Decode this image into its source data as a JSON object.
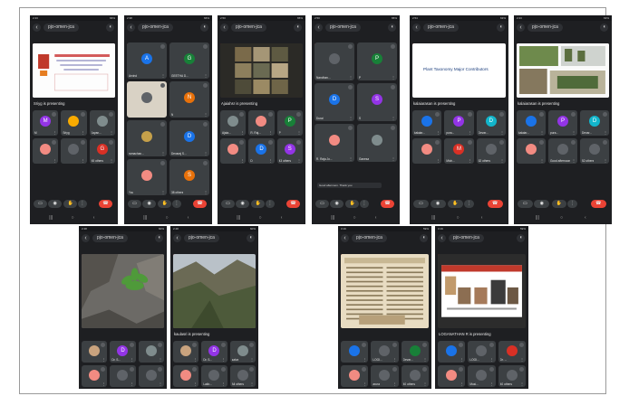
{
  "meeting_code": "pjo-omen-jca",
  "chips": [
    "G",
    "R",
    "M"
  ],
  "phones": [
    {
      "status_time": "2:43",
      "status_right": "66%",
      "presenting": "Sriyg is presenting",
      "tiles": [
        {
          "initial": "M",
          "name": "M",
          "color": "#9334e6"
        },
        {
          "initial": "",
          "name": "Sriyg",
          "color": "#f9ab00"
        },
        {
          "initial": "",
          "name": "Jayan...",
          "color": "#7f8c8d"
        },
        {
          "initial": "",
          "name": "",
          "color": "#f28b82"
        },
        {
          "initial": "",
          "name": "",
          "color": "#5f6368"
        },
        {
          "initial": "G",
          "name": "45 others",
          "color": "#d93025"
        }
      ]
    },
    {
      "status_time": "2:38",
      "status_right": "66%",
      "tiles": [
        {
          "initial": "A",
          "name": "Arvind",
          "color": "#1a73e8"
        },
        {
          "initial": "G",
          "name": "GEETHA D...",
          "color": "#188038"
        },
        {
          "initial": "",
          "name": "",
          "color": "#5f6368"
        },
        {
          "initial": "N",
          "name": "N",
          "color": "#e8710a"
        },
        {
          "initial": "",
          "name": "ramachan...",
          "color": "#c5a04a"
        },
        {
          "initial": "D",
          "name": "Devaraj S...",
          "color": "#1a73e8"
        },
        {
          "initial": "",
          "name": "You",
          "color": "#f28b82"
        },
        {
          "initial": "S",
          "name": "38 others",
          "color": "#e8710a"
        }
      ]
    },
    {
      "status_time": "2:50",
      "status_right": "65%",
      "presenting": "Ajaiahsr is presenting",
      "tiles": [
        {
          "initial": "",
          "name": "Ajaia...",
          "color": "#7f8c8d"
        },
        {
          "initial": "",
          "name": "R. Raj...",
          "color": "#f28b82"
        },
        {
          "initial": "P",
          "name": "P",
          "color": "#188038"
        },
        {
          "initial": "",
          "name": "",
          "color": "#f28b82"
        },
        {
          "initial": "D",
          "name": "D",
          "color": "#1a73e8"
        },
        {
          "initial": "S",
          "name": "43 others",
          "color": "#9334e6"
        }
      ]
    },
    {
      "status_time": "2:50",
      "status_right": "65%",
      "tiles": [
        {
          "initial": "",
          "name": "Nandhan...",
          "color": "#5f6368"
        },
        {
          "initial": "P",
          "name": "P",
          "color": "#188038"
        },
        {
          "initial": "D",
          "name": "Durai",
          "color": "#1a73e8"
        },
        {
          "initial": "S",
          "name": "S",
          "color": "#9334e6"
        },
        {
          "initial": "",
          "name": "R. Raja Jo...",
          "color": "#f28b82"
        },
        {
          "initial": "",
          "name": "Ganesa",
          "color": "#7f8c8d"
        }
      ],
      "toast": "Good afternoon. Thank you"
    },
    {
      "status_time": "2:54",
      "status_right": "63%",
      "presenting": "kalaiarasan is presenting",
      "slide_title": "Plant Taxonomy Major Contributors",
      "tiles": [
        {
          "initial": "",
          "name": "kalaiar...",
          "color": "#1a73e8"
        },
        {
          "initial": "P",
          "name": "pura...",
          "color": "#9334e6"
        },
        {
          "initial": "D",
          "name": "Devar...",
          "color": "#12b5cb"
        },
        {
          "initial": "",
          "name": "",
          "color": "#f28b82"
        },
        {
          "initial": "M",
          "name": "Mich...",
          "color": "#d93025"
        },
        {
          "initial": "",
          "name": "52 others",
          "color": "#5f6368"
        }
      ]
    },
    {
      "status_time": "2:43",
      "status_right": "63%",
      "presenting": "kalaiarasan is presenting",
      "tiles": [
        {
          "initial": "",
          "name": "kalaiar...",
          "color": "#1a73e8"
        },
        {
          "initial": "P",
          "name": "pura...",
          "color": "#9334e6"
        },
        {
          "initial": "D",
          "name": "Devar...",
          "color": "#12b5cb"
        },
        {
          "initial": "",
          "name": "",
          "color": "#f28b82"
        },
        {
          "initial": "",
          "name": "Good afternoon",
          "color": "#5f6368"
        },
        {
          "initial": "",
          "name": "52 others",
          "color": "#5f6368"
        }
      ]
    },
    {
      "status_time": "2:48",
      "status_right": "60%",
      "tiles": [
        {
          "initial": "",
          "name": "",
          "color": "#c9a37e"
        },
        {
          "initial": "D",
          "name": "Dr. S...",
          "color": "#9334e6"
        },
        {
          "initial": "",
          "name": "",
          "color": "#7f8c8d"
        },
        {
          "initial": "",
          "name": "",
          "color": "#f28b82"
        },
        {
          "initial": "",
          "name": "",
          "color": "#5f6368"
        },
        {
          "initial": "",
          "name": "",
          "color": "#5f6368"
        }
      ]
    },
    {
      "status_time": "2:48",
      "status_right": "60%",
      "presenting": "kaulasri is presenting",
      "tiles": [
        {
          "initial": "",
          "name": "",
          "color": "#c9a37e"
        },
        {
          "initial": "D",
          "name": "Dr. S...",
          "color": "#9334e6"
        },
        {
          "initial": "",
          "name": "salva",
          "color": "#7f8c8d"
        },
        {
          "initial": "",
          "name": "",
          "color": "#f28b82"
        },
        {
          "initial": "",
          "name": "Lakb...",
          "color": "#5f6368"
        },
        {
          "initial": "",
          "name": "All others",
          "color": "#5f6368"
        }
      ]
    },
    {
      "status_time": "3:19",
      "status_right": "59%",
      "tiles": [
        {
          "initial": "",
          "name": "",
          "color": "#1a73e8"
        },
        {
          "initial": "",
          "name": "LOGI...",
          "color": "#5f6368"
        },
        {
          "initial": "",
          "name": "Devar...",
          "color": "#188038"
        },
        {
          "initial": "",
          "name": "",
          "color": "#f28b82"
        },
        {
          "initial": "",
          "name": "aruna",
          "color": "#5f6368"
        },
        {
          "initial": "",
          "name": "40 others",
          "color": "#5f6368"
        }
      ]
    },
    {
      "status_time": "3:19",
      "status_right": "59%",
      "presenting": "LOGANATHAN R is presenting",
      "tiles": [
        {
          "initial": "",
          "name": "",
          "color": "#1a73e8"
        },
        {
          "initial": "",
          "name": "LOGI...",
          "color": "#5f6368"
        },
        {
          "initial": "",
          "name": "Dr. ...",
          "color": "#d93025"
        },
        {
          "initial": "",
          "name": "",
          "color": "#f28b82"
        },
        {
          "initial": "",
          "name": "Musi...",
          "color": "#5f6368"
        },
        {
          "initial": "",
          "name": "40 others",
          "color": "#5f6368"
        }
      ]
    }
  ]
}
